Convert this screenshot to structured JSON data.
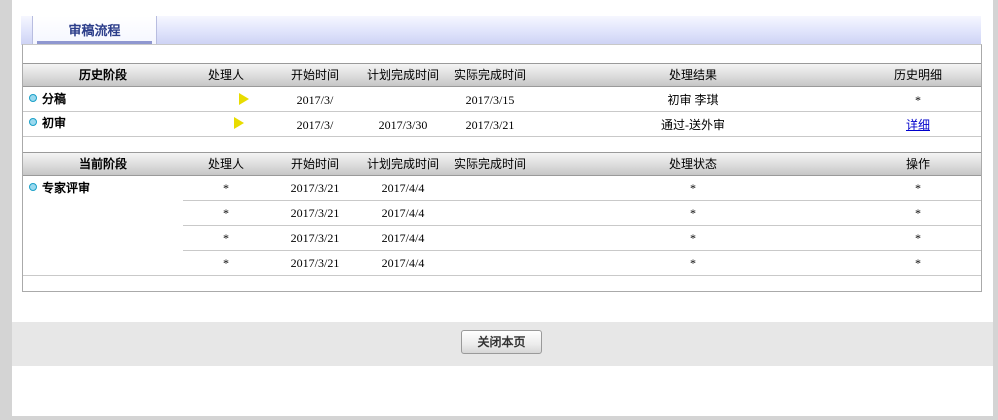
{
  "tab": {
    "title": "审稿流程"
  },
  "history": {
    "headers": [
      "历史阶段",
      "处理人",
      "开始时间",
      "计划完成时间",
      "实际完成时间",
      "处理结果",
      "历史明细"
    ],
    "rows": [
      {
        "stage": "分稿",
        "handler": "",
        "start": "2017/3/",
        "planned": "",
        "actual": "2017/3/15",
        "result": "初审  李琪",
        "detail": "*"
      },
      {
        "stage": "初审",
        "handler": "",
        "start": "2017/3/",
        "planned": "2017/3/30",
        "actual": "2017/3/21",
        "result": "通过-送外审",
        "detail": "详细"
      }
    ]
  },
  "current": {
    "headers": [
      "当前阶段",
      "处理人",
      "开始时间",
      "计划完成时间",
      "实际完成时间",
      "处理状态",
      "操作"
    ],
    "stage": "专家评审",
    "rows": [
      {
        "handler": "*",
        "start": "2017/3/21",
        "planned": "2017/4/4",
        "actual": "",
        "status": "*",
        "op": "*"
      },
      {
        "handler": "*",
        "start": "2017/3/21",
        "planned": "2017/4/4",
        "actual": "",
        "status": "*",
        "op": "*"
      },
      {
        "handler": "*",
        "start": "2017/3/21",
        "planned": "2017/4/4",
        "actual": "",
        "status": "*",
        "op": "*"
      },
      {
        "handler": "*",
        "start": "2017/3/21",
        "planned": "2017/4/4",
        "actual": "",
        "status": "*",
        "op": "*"
      }
    ]
  },
  "footer": {
    "close_label": "关闭本页"
  },
  "icons": {
    "stage_bullet": "bullet-icon",
    "handler_marker": "yellow-arrow-icon"
  },
  "colors": {
    "link": "#0000cc",
    "tab_text": "#2b3d8a",
    "bullet": "#1aa0c8"
  }
}
